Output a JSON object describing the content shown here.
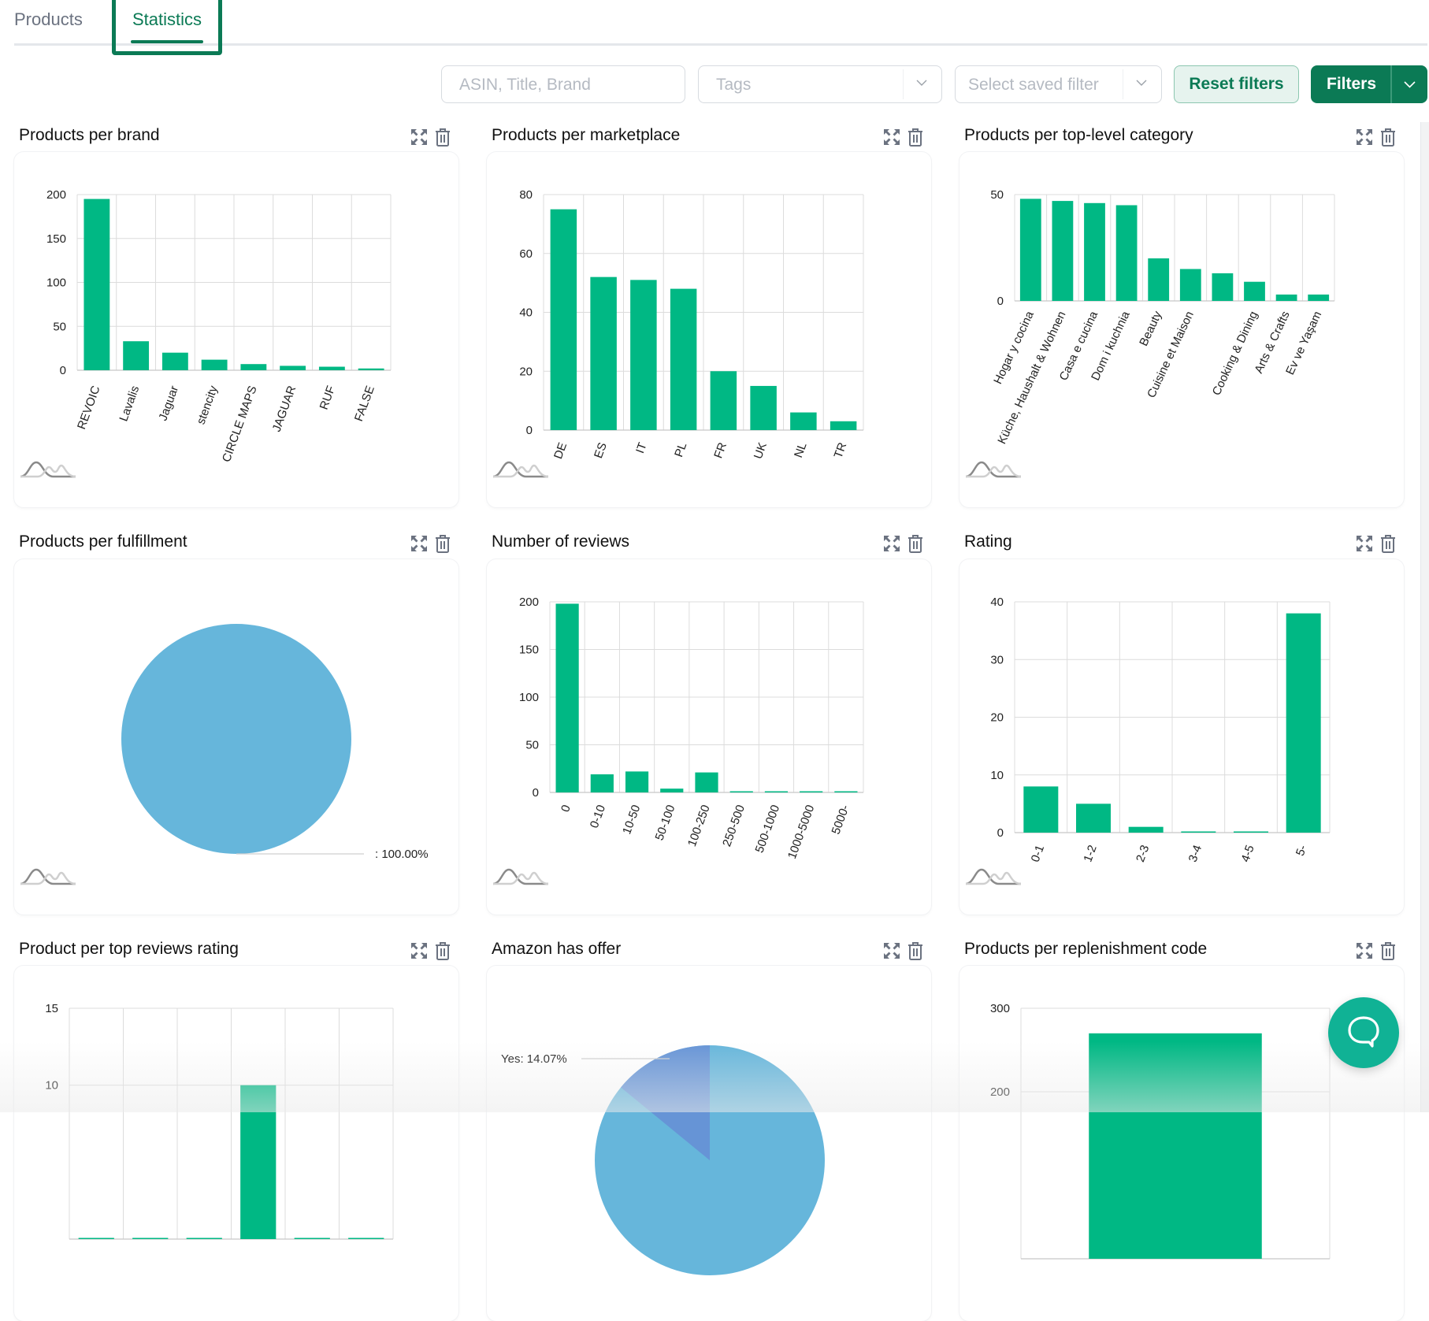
{
  "tabs": [
    {
      "label": "Products",
      "active": false
    },
    {
      "label": "Statistics",
      "active": true
    }
  ],
  "filters": {
    "search_placeholder": "ASIN, Title, Brand",
    "tags_placeholder": "Tags",
    "saved_filter_placeholder": "Select saved filter",
    "reset_label": "Reset filters",
    "filters_label": "Filters"
  },
  "colors": {
    "brand": "#0b7a55",
    "bar": "#00b884",
    "pie_primary": "#66b6db",
    "pie_secondary": "#6694d6",
    "chat": "#10b295"
  },
  "chart_data": [
    {
      "id": "brand",
      "type": "bar",
      "title": "Products per brand",
      "categories": [
        "REVOIC",
        "Lavalis",
        "Jaguar",
        "stencity",
        "CIRCLE MAPS",
        "JAGUAR",
        "RUF",
        "FALSE"
      ],
      "values": [
        195,
        33,
        20,
        12,
        7,
        5,
        4,
        2
      ],
      "yticks": [
        0,
        50,
        100,
        150,
        200
      ],
      "ylim": [
        0,
        200
      ],
      "xlabel": "",
      "ylabel": "",
      "grid": true
    },
    {
      "id": "marketplace",
      "type": "bar",
      "title": "Products per marketplace",
      "categories": [
        "DE",
        "ES",
        "IT",
        "PL",
        "FR",
        "UK",
        "NL",
        "TR"
      ],
      "values": [
        75,
        52,
        51,
        48,
        20,
        15,
        6,
        3
      ],
      "yticks": [
        0,
        20,
        40,
        60,
        80
      ],
      "ylim": [
        0,
        80
      ],
      "xlabel": "",
      "ylabel": "",
      "grid": true
    },
    {
      "id": "category",
      "type": "bar",
      "title": "Products per top-level category",
      "categories": [
        "Hogar y cocina",
        "Küche, Haushalt & Wohnen",
        "Casa e cucina",
        "Dom i kuchnia",
        "Beauty",
        "Cuisine et Maison",
        "",
        "Cooking & Dining",
        "Arts & Crafts",
        "Ev ve Yaşam"
      ],
      "values": [
        48,
        47,
        46,
        45,
        20,
        15,
        13,
        9,
        3,
        3
      ],
      "yticks": [
        0,
        50
      ],
      "ylim": [
        0,
        50
      ],
      "xlabel": "",
      "ylabel": "",
      "grid": true
    },
    {
      "id": "fulfillment",
      "type": "pie",
      "title": "Products per fulfillment",
      "slices": [
        {
          "label": "",
          "percent": 100.0
        }
      ],
      "data_labels": [
        ": 100.00%"
      ]
    },
    {
      "id": "reviews",
      "type": "bar",
      "title": "Number of reviews",
      "categories": [
        "0",
        "0-10",
        "10-50",
        "50-100",
        "100-250",
        "250-500",
        "500-1000",
        "1000-5000",
        "5000-"
      ],
      "values": [
        198,
        19,
        22,
        4,
        21,
        0.5,
        0.5,
        0.5,
        0.5
      ],
      "yticks": [
        0,
        50,
        100,
        150,
        200
      ],
      "ylim": [
        0,
        200
      ],
      "xlabel": "",
      "ylabel": "",
      "grid": true
    },
    {
      "id": "rating",
      "type": "bar",
      "title": "Rating",
      "categories": [
        "0-1",
        "1-2",
        "2-3",
        "3-4",
        "4-5",
        "5-"
      ],
      "values": [
        8,
        5,
        1,
        0.1,
        0.1,
        38
      ],
      "yticks": [
        0,
        10,
        20,
        30,
        40
      ],
      "ylim": [
        0,
        40
      ],
      "xlabel": "",
      "ylabel": "",
      "grid": true
    },
    {
      "id": "top_reviews",
      "type": "bar",
      "title": "Product per top reviews rating",
      "categories": [
        "",
        "",
        "",
        "",
        "",
        ""
      ],
      "values": [
        0,
        0,
        0,
        10,
        0,
        0
      ],
      "yticks": [
        10,
        15
      ],
      "ylim": [
        0,
        15
      ],
      "xlabel": "",
      "ylabel": "",
      "grid": true
    },
    {
      "id": "amazon_offer",
      "type": "pie",
      "title": "Amazon has offer",
      "slices": [
        {
          "label": "Yes",
          "percent": 14.07
        },
        {
          "label": "",
          "percent": 85.93
        }
      ],
      "data_labels": [
        "Yes: 14.07%"
      ]
    },
    {
      "id": "replenishment",
      "type": "bar",
      "title": "Products per replenishment code",
      "categories": [
        ""
      ],
      "values": [
        270
      ],
      "yticks": [
        200,
        300
      ],
      "ylim": [
        0,
        300
      ],
      "xlabel": "",
      "ylabel": "",
      "grid": true
    }
  ],
  "icons": {
    "expand": "expand-arrows-icon",
    "delete": "trash-icon",
    "distribution": "distribution-curve-icon",
    "chat": "chat-bubble-icon"
  }
}
